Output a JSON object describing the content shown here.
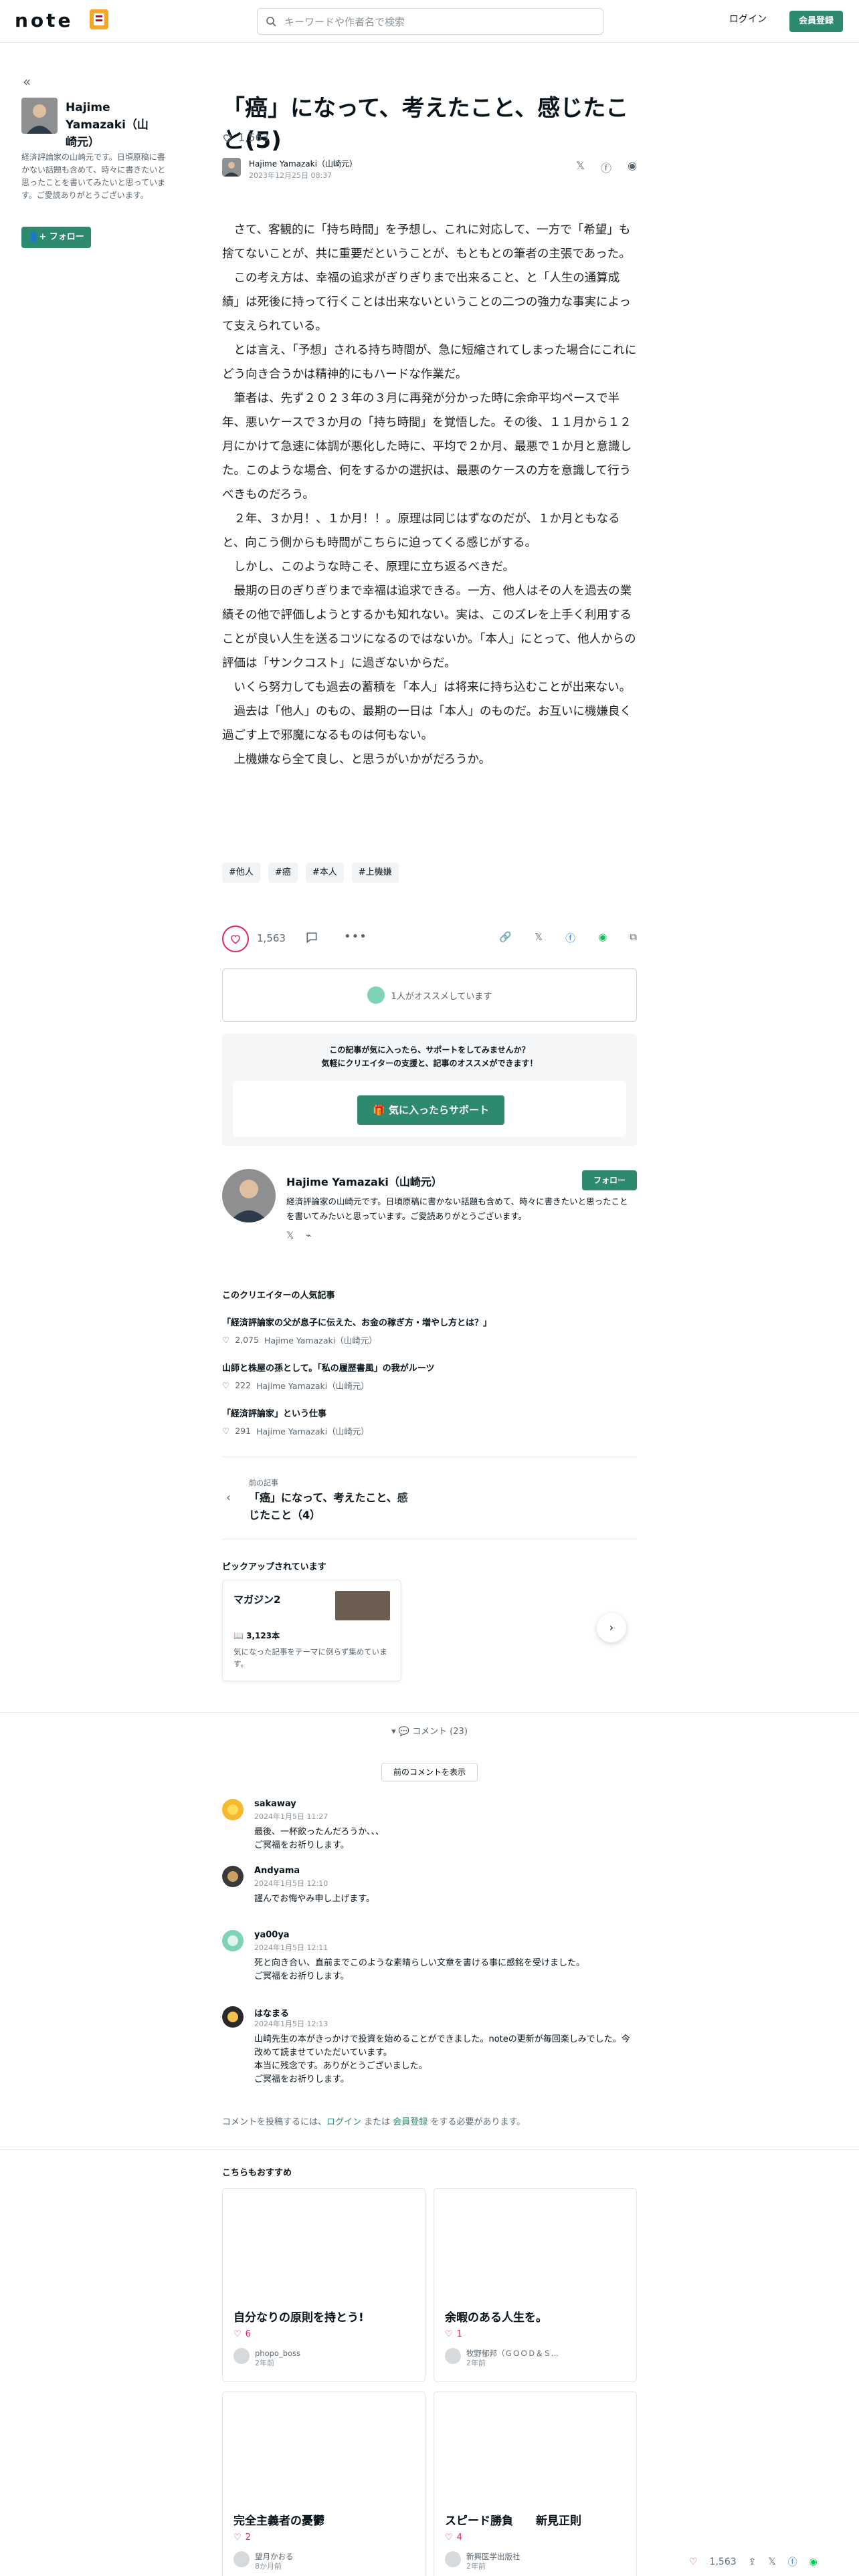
{
  "header": {
    "logo_text": "note",
    "search_placeholder": "キーワードや作者名で検索",
    "login_label": "ログイン",
    "register_label": "会員登録"
  },
  "sidebar": {
    "author_name": "Hajime Yamazaki（山崎元）",
    "bio": "経済評論家の山崎元です。日頃原稿に書かない話題も含めて、時々に書きたいと思ったことを書いてみたいと思っています。ご愛読ありがとうございます。",
    "follow_label": "フォロー"
  },
  "article": {
    "title": "「癌」になって、考えたこと、感じたこと(5)",
    "likes": "1,563",
    "author": "Hajime Yamazaki（山崎元）",
    "date": "2023年12月25日 08:37",
    "paragraphs": [
      "さて、客観的に「持ち時間」を予想し、これに対応して、一方で「希望」も捨てないことが、共に重要だということが、もともとの筆者の主張であった。",
      "この考え方は、幸福の追求がぎりぎりまで出来ること、と「人生の通算成績」は死後に持って行くことは出来ないということの二つの強力な事実によって支えられている。",
      "とは言え、「予想」される持ち時間が、急に短縮されてしまった場合にこれにどう向き合うかは精神的にもハードな作業だ。",
      "筆者は、先ず２０２３年の３月に再発が分かった時に余命平均ペースで半年、悪いケースで３か月の「持ち時間」を覚悟した。その後、１１月から１２月にかけて急速に体調が悪化した時に、平均で２か月、最悪で１か月と意識した。このような場合、何をするかの選択は、最悪のケースの方を意識して行うべきものだろう。",
      "２年、３か月！、１か月！！。原理は同じはずなのだが、１か月ともなると、向こう側からも時間がこちらに迫ってくる感じがする。",
      "しかし、このような時こそ、原理に立ち返るべきだ。",
      "最期の日のぎりぎりまで幸福は追求できる。一方、他人はその人を過去の業績その他で評価しようとするかも知れない。実は、このズレを上手く利用することが良い人生を送るコツになるのではないか。「本人」にとって、他人からの評価は「サンクコスト」に過ぎないからだ。",
      "いくら努力しても過去の蓄積を「本人」は将来に持ち込むことが出来ない。",
      "過去は「他人」のもの、最期の一日は「本人」のものだ。お互いに機嫌良く過ごす上で邪魔になるものは何もない。",
      "上機嫌なら全て良し、と思うがいかがだろうか。"
    ],
    "tags": [
      "#他人",
      "#癌",
      "#本人",
      "#上機嫌"
    ]
  },
  "actions": {
    "likes": "1,563",
    "recommend_text": "1人がオススメしています",
    "support_line1": "この記事が気に入ったら、サポートをしてみませんか？",
    "support_line2": "気軽にクリエイターの支援と、記事のオススメができます！",
    "support_button": "気に入ったらサポート"
  },
  "creator": {
    "name": "Hajime Yamazaki（山崎元）",
    "bio": "経済評論家の山崎元です。日頃原稿に書かない話題も含めて、時々に書きたいと思ったことを書いてみたいと思っています。ご愛読ありがとうございます。",
    "follow_label": "フォロー"
  },
  "popular": {
    "heading": "このクリエイターの人気記事",
    "items": [
      {
        "title": "「経済評論家の父が息子に伝えた、お金の稼ぎ方・増やし方とは？」",
        "likes": "2,075",
        "author": "Hajime Yamazaki（山崎元）"
      },
      {
        "title": "山師と株屋の孫として。「私の履歴書風」の我がルーツ",
        "likes": "222",
        "author": "Hajime Yamazaki（山崎元）"
      },
      {
        "title": "「経済評論家」という仕事",
        "likes": "291",
        "author": "Hajime Yamazaki（山崎元）"
      }
    ]
  },
  "prev_article": {
    "label": "前の記事",
    "title": "「癌」になって、考えたこと、感じたこと（4）"
  },
  "pickup": {
    "heading": "ピックアップされています",
    "magazine_title": "マガジン2",
    "count": "3,123本",
    "desc": "気になった記事をテーマに例らず集めています。"
  },
  "comments": {
    "toggle_label": "コメント (23)",
    "prev_label": "前のコメントを表示",
    "items": [
      {
        "name": "sakaway",
        "date": "2024年1月5日 11:27",
        "text": "最後、一杯飲ったんだろうか、、、\nご冥福をお祈りします。"
      },
      {
        "name": "Andyama",
        "date": "2024年1月5日 12:10",
        "text": "謹んでお悔やみ申し上げます。"
      },
      {
        "name": "ya00ya",
        "date": "2024年1月5日 12:11",
        "text": "死と向き合い、直前までこのような素晴らしい文章を書ける事に感銘を受けました。\nご冥福をお祈りします。"
      },
      {
        "name": "はなまる",
        "date": "2024年1月5日 12:13",
        "text": "山崎先生の本がきっかけで投資を始めることができました。noteの更新が毎回楽しみでした。今改めて読ませていただいています。\n本当に残念です。ありがとうございました。\nご冥福をお祈りします。"
      }
    ],
    "post_note_prefix": "コメントを投稿するには、",
    "post_note_login": "ログイン",
    "post_note_mid": " または ",
    "post_note_register": "会員登録",
    "post_note_suffix": " をする必要があります。"
  },
  "recommend": {
    "heading": "こちらもおすすめ",
    "cards": [
      {
        "title": "自分なりの原則を持とう!",
        "likes": "6",
        "author": "phopo_boss",
        "ago": "2年前"
      },
      {
        "title": "余暇のある人生を。",
        "likes": "1",
        "author": "牧野郁邦（ＧＯＯＤ＆Ｓ…",
        "ago": "2年前"
      },
      {
        "title": "完全主義者の憂鬱",
        "likes": "2",
        "author": "望月かおる",
        "ago": "8か月前"
      },
      {
        "title": "スピード勝負　　新見正則",
        "likes": "4",
        "author": "新興医学出版社",
        "ago": "2年前"
      }
    ]
  },
  "float_bar": {
    "likes": "1,563"
  },
  "colors": {
    "accent": "#2e8a6e",
    "like": "#e0245e",
    "text": "#08131a",
    "muted": "#5b6770"
  }
}
